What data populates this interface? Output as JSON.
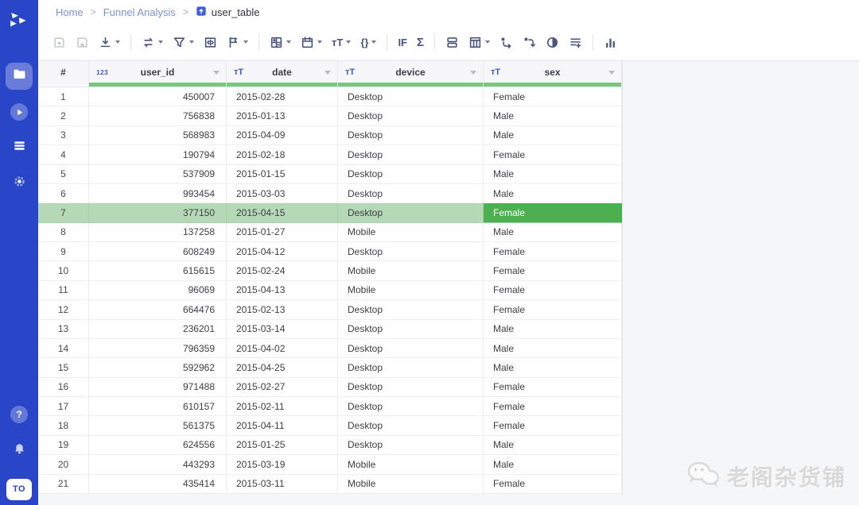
{
  "breadcrumb": {
    "items": [
      "Home",
      "Funnel Analysis",
      "user_table"
    ],
    "separator": ">"
  },
  "sidebar": {
    "logo": "app-logo",
    "items": [
      {
        "icon": "folder-icon",
        "active": true
      },
      {
        "icon": "play-icon",
        "active": false
      },
      {
        "icon": "layers-icon",
        "active": false
      },
      {
        "icon": "gear-icon",
        "active": false
      }
    ],
    "bottom_items": [
      {
        "icon": "help-icon"
      },
      {
        "icon": "bell-icon"
      }
    ],
    "avatar": "TO"
  },
  "toolbar": {
    "groups": [
      {
        "items": [
          {
            "icon": "save-as-icon",
            "disabled": true
          },
          {
            "icon": "save-icon",
            "disabled": true
          },
          {
            "icon": "download-icon",
            "caret": true
          }
        ]
      },
      {
        "items": [
          {
            "icon": "swap-icon",
            "caret": true
          },
          {
            "icon": "filter-icon",
            "caret": true
          },
          {
            "icon": "fit-columns-icon"
          },
          {
            "icon": "flag-icon",
            "caret": true
          }
        ]
      },
      {
        "items": [
          {
            "icon": "calculate-icon",
            "caret": true
          },
          {
            "icon": "calendar-icon",
            "caret": true
          },
          {
            "icon": "text-format-icon",
            "label": "тT",
            "caret": true
          },
          {
            "icon": "braces-icon",
            "label": "{}",
            "caret": true
          }
        ]
      },
      {
        "items": [
          {
            "icon": "if-icon",
            "label": "IF"
          },
          {
            "icon": "sigma-icon",
            "label": "Σ",
            "big": true
          }
        ]
      },
      {
        "items": [
          {
            "icon": "group-rows-icon"
          },
          {
            "icon": "table-columns-icon",
            "caret": true
          },
          {
            "icon": "pivot-icon"
          },
          {
            "icon": "unpivot-icon"
          },
          {
            "icon": "contrast-icon"
          },
          {
            "icon": "append-rows-icon"
          }
        ]
      },
      {
        "items": [
          {
            "icon": "chart-icon"
          }
        ]
      }
    ]
  },
  "table": {
    "columns": [
      {
        "label": "#",
        "type": "",
        "menu": false
      },
      {
        "label": "user_id",
        "type": "123",
        "menu": true
      },
      {
        "label": "date",
        "type": "тT",
        "menu": true
      },
      {
        "label": "device",
        "type": "тT",
        "menu": true
      },
      {
        "label": "sex",
        "type": "тT",
        "menu": true
      }
    ],
    "rows": [
      [
        "1",
        "450007",
        "2015-02-28",
        "Desktop",
        "Female"
      ],
      [
        "2",
        "756838",
        "2015-01-13",
        "Desktop",
        "Male"
      ],
      [
        "3",
        "568983",
        "2015-04-09",
        "Desktop",
        "Male"
      ],
      [
        "4",
        "190794",
        "2015-02-18",
        "Desktop",
        "Female"
      ],
      [
        "5",
        "537909",
        "2015-01-15",
        "Desktop",
        "Male"
      ],
      [
        "6",
        "993454",
        "2015-03-03",
        "Desktop",
        "Male"
      ],
      [
        "7",
        "377150",
        "2015-04-15",
        "Desktop",
        "Female"
      ],
      [
        "8",
        "137258",
        "2015-01-27",
        "Mobile",
        "Male"
      ],
      [
        "9",
        "608249",
        "2015-04-12",
        "Desktop",
        "Female"
      ],
      [
        "10",
        "615615",
        "2015-02-24",
        "Mobile",
        "Female"
      ],
      [
        "11",
        "96069",
        "2015-04-13",
        "Mobile",
        "Female"
      ],
      [
        "12",
        "664476",
        "2015-02-13",
        "Desktop",
        "Female"
      ],
      [
        "13",
        "236201",
        "2015-03-14",
        "Desktop",
        "Male"
      ],
      [
        "14",
        "796359",
        "2015-04-02",
        "Desktop",
        "Male"
      ],
      [
        "15",
        "592962",
        "2015-04-25",
        "Desktop",
        "Male"
      ],
      [
        "16",
        "971488",
        "2015-02-27",
        "Desktop",
        "Female"
      ],
      [
        "17",
        "610157",
        "2015-02-11",
        "Desktop",
        "Female"
      ],
      [
        "18",
        "561375",
        "2015-04-11",
        "Desktop",
        "Female"
      ],
      [
        "19",
        "624556",
        "2015-01-25",
        "Desktop",
        "Male"
      ],
      [
        "20",
        "443293",
        "2015-03-19",
        "Mobile",
        "Male"
      ],
      [
        "21",
        "435414",
        "2015-03-11",
        "Mobile",
        "Female"
      ]
    ],
    "selection": {
      "row": 7,
      "column": "sex"
    }
  },
  "watermark": {
    "text": "老阁杂货铺"
  },
  "colors": {
    "sidebar_blue": "#2946c8",
    "selection_green": "#4caf50",
    "selection_light_green": "#b5d9b6",
    "quality_bar_green": "#7cc57e",
    "toolbar_icon": "#4a5480",
    "type_icon_blue": "#3d5bd7",
    "breadcrumb_link": "#7b91dc"
  }
}
